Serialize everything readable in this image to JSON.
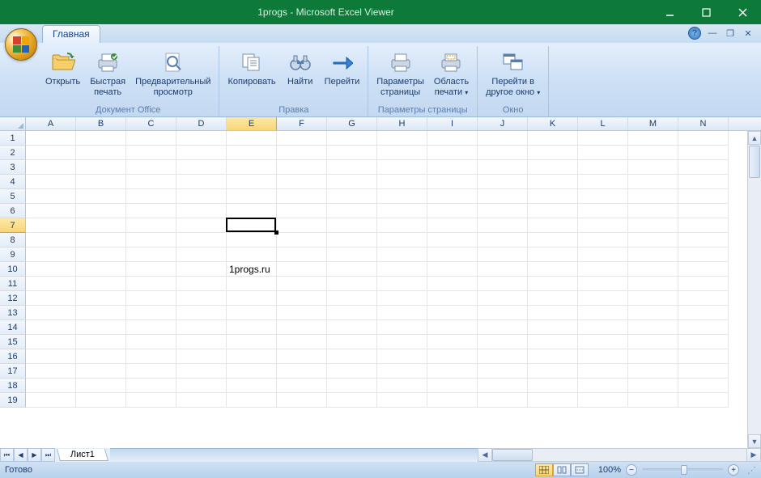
{
  "window": {
    "title": "1progs - Microsoft Excel Viewer"
  },
  "tabs": {
    "main": "Главная"
  },
  "ribbon": {
    "groups": {
      "office_doc": {
        "label": "Документ Office",
        "open": "Открыть",
        "quick_print": "Быстрая\nпечать",
        "preview": "Предварительный\nпросмотр"
      },
      "edit": {
        "label": "Правка",
        "copy": "Копировать",
        "find": "Найти",
        "go_to": "Перейти"
      },
      "page_setup": {
        "label": "Параметры страницы",
        "page_params": "Параметры\nстраницы",
        "print_area": "Область\nпечати"
      },
      "window": {
        "label": "Окно",
        "switch_window": "Перейти в\nдругое окно"
      }
    }
  },
  "columns": [
    "A",
    "B",
    "C",
    "D",
    "E",
    "F",
    "G",
    "H",
    "I",
    "J",
    "K",
    "L",
    "M",
    "N"
  ],
  "rows": [
    "1",
    "2",
    "3",
    "4",
    "5",
    "6",
    "7",
    "8",
    "9",
    "10",
    "11",
    "12",
    "13",
    "14",
    "15",
    "16",
    "17",
    "18",
    "19"
  ],
  "selected": {
    "col": "E",
    "row": "7",
    "colIndex": 4,
    "rowIndex": 6
  },
  "cells": {
    "E10": "1progs.ru"
  },
  "sheet_tabs": {
    "sheet1": "Лист1"
  },
  "status": {
    "ready": "Готово",
    "zoom": "100%"
  }
}
